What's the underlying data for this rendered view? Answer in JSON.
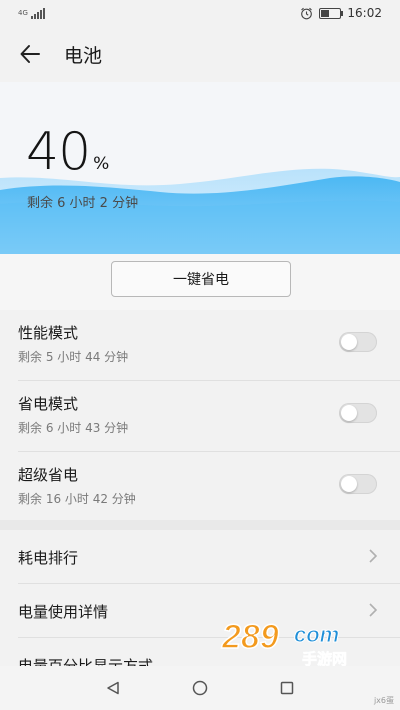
{
  "status_bar": {
    "network": "4G",
    "time": "16:02",
    "battery_level": 0.4,
    "icons": [
      "signal-icon",
      "alarm-icon",
      "battery-icon"
    ]
  },
  "app_bar": {
    "title": "电池",
    "back_icon": "arrow-left-icon"
  },
  "hero": {
    "percent": "40",
    "percent_unit": "%",
    "remaining": "剩余 6 小时 2 分钟",
    "wave_color": "#2aa6ef"
  },
  "one_key_save": {
    "label": "一键省电"
  },
  "modes": [
    {
      "title": "性能模式",
      "subtitle": "剩余 5 小时 44 分钟",
      "enabled": false
    },
    {
      "title": "省电模式",
      "subtitle": "剩余 6 小时 43 分钟",
      "enabled": false
    },
    {
      "title": "超级省电",
      "subtitle": "剩余 16 小时 42 分钟",
      "enabled": false
    }
  ],
  "nav_items": [
    {
      "label": "耗电排行"
    },
    {
      "label": "电量使用详情"
    },
    {
      "label": "电量百分比显示方式"
    }
  ],
  "watermark": {
    "main": "289",
    "suffix": "com",
    "sub": "手游网"
  },
  "bottom_nav": {
    "icons": [
      "back-triangle-icon",
      "home-circle-icon",
      "recents-square-icon"
    ]
  },
  "corner_mark": "jx6蛋",
  "colors": {
    "accent": "#2aa6ef",
    "background": "#f2f2f2",
    "watermark_orange": "#f39a1e",
    "watermark_blue": "#1f8fd8"
  }
}
